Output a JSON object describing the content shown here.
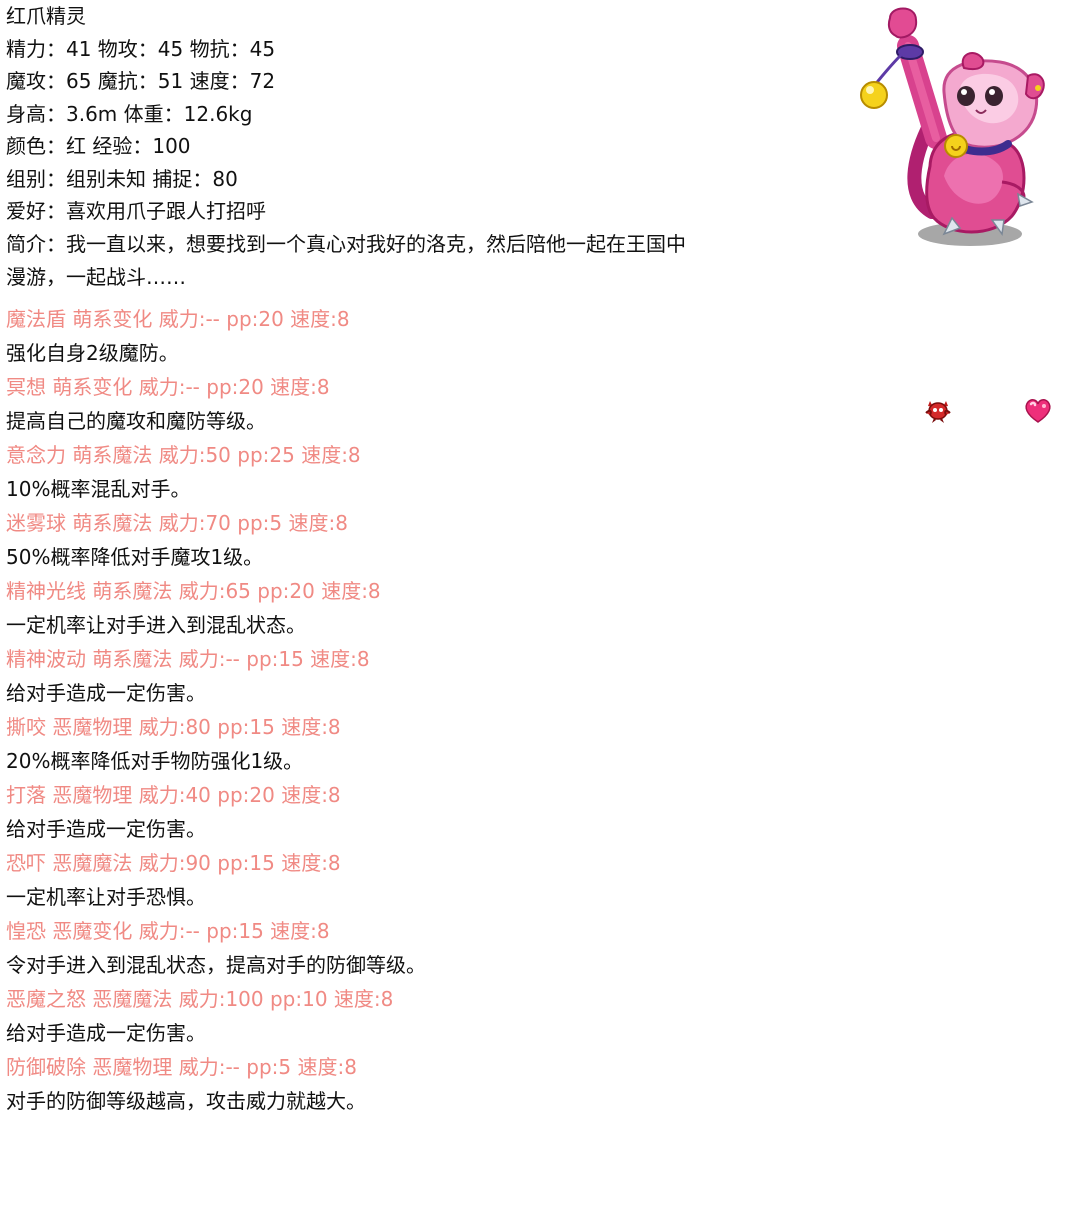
{
  "pet": {
    "name": "红爪精灵",
    "stats_line1": "精力：41 物攻：45 物抗：45",
    "stats_line2": "魔攻：65 魔抗：51 速度：72",
    "stats_line3": "身高：3.6m 体重：12.6kg",
    "stats_line4": "颜色：红 经验：100",
    "stats_line5": "组别：组别未知 捕捉：80",
    "hobby": "爱好：喜欢用爪子跟人打招呼",
    "intro": "简介：我一直以来，想要找到一个真心对我好的洛克，然后陪他一起在王国中漫游，一起战斗……"
  },
  "skills": [
    {
      "head": "魔法盾 萌系变化 威力:-- pp:20 速度:8",
      "desc": "强化自身2级魔防。"
    },
    {
      "head": "冥想 萌系变化 威力:-- pp:20 速度:8",
      "desc": "提高自己的魔攻和魔防等级。"
    },
    {
      "head": "意念力 萌系魔法 威力:50 pp:25 速度:8",
      "desc": "10%概率混乱对手。"
    },
    {
      "head": "迷雾球 萌系魔法 威力:70 pp:5 速度:8",
      "desc": "50%概率降低对手魔攻1级。"
    },
    {
      "head": "精神光线 萌系魔法 威力:65 pp:20 速度:8",
      "desc": "一定机率让对手进入到混乱状态。"
    },
    {
      "head": "精神波动 萌系魔法 威力:-- pp:15 速度:8",
      "desc": "给对手造成一定伤害。"
    },
    {
      "head": "撕咬 恶魔物理 威力:80 pp:15 速度:8",
      "desc": "20%概率降低对手物防强化1级。"
    },
    {
      "head": "打落 恶魔物理 威力:40 pp:20 速度:8",
      "desc": "给对手造成一定伤害。"
    },
    {
      "head": "恐吓 恶魔魔法 威力:90 pp:15 速度:8",
      "desc": "一定机率让对手恐惧。"
    },
    {
      "head": "惶恐 恶魔变化 威力:-- pp:15 速度:8",
      "desc": "令对手进入到混乱状态，提高对手的防御等级。"
    },
    {
      "head": "恶魔之怒 恶魔魔法 威力:100 pp:10 速度:8",
      "desc": "给对手造成一定伤害。"
    },
    {
      "head": "防御破除 恶魔物理 威力:-- pp:5 速度:8",
      "desc": "对手的防御等级越高，攻击威力就越大。"
    }
  ],
  "colors": {
    "skill_head": "#f08a84",
    "text": "#111111"
  },
  "icons": {
    "mascot": "pet-portrait-icon",
    "type1": "devil-type-icon",
    "type2": "heart-type-icon"
  }
}
